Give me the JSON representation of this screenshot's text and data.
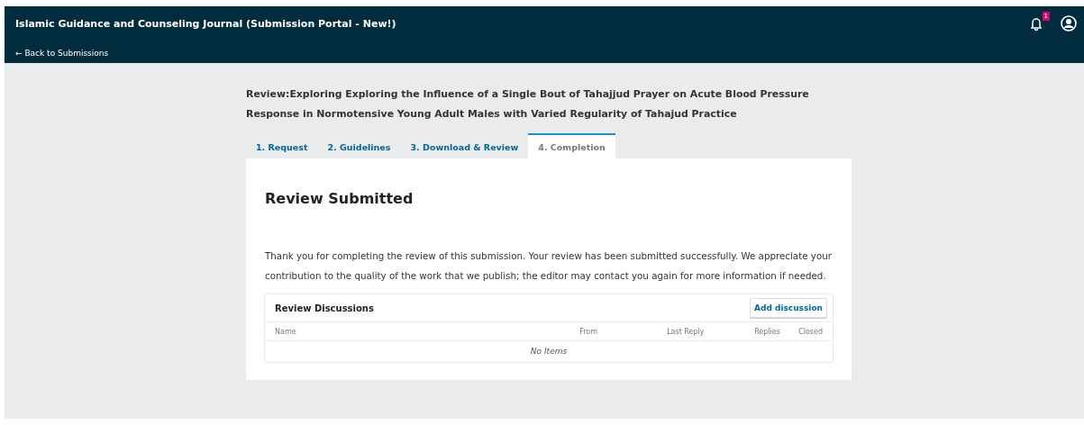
{
  "header": {
    "title": "Islamic Guidance and Counseling Journal (Submission Portal - New!)",
    "back_link": "← Back to Submissions",
    "notifications": {
      "count": "1"
    }
  },
  "review_title": "Review:Exploring Exploring the Influence of a Single Bout of Tahajjud Prayer on Acute Blood Pressure Response in Normotensive Young Adult Males with Varied Regularity of Tahajud Practice",
  "tabs": [
    {
      "label": "1. Request",
      "selected": false
    },
    {
      "label": "2. Guidelines",
      "selected": false
    },
    {
      "label": "3. Download & Review",
      "selected": false
    },
    {
      "label": "4. Completion",
      "selected": true
    }
  ],
  "panel": {
    "heading": "Review Submitted",
    "message": "Thank you for completing the review of this submission. Your review has been submitted successfully. We appreciate your contribution to the quality of the work that we publish; the editor may contact you again for more information if needed."
  },
  "discussions": {
    "title": "Review Discussions",
    "button": "Add discussion",
    "columns": [
      "Name",
      "From",
      "Last Reply",
      "Replies",
      "Closed"
    ],
    "empty": "No Items"
  }
}
